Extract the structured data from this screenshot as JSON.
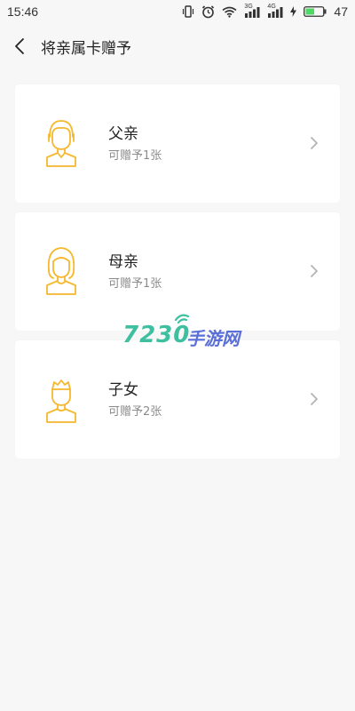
{
  "status_bar": {
    "time": "15:46",
    "sim1_label": "3G",
    "sim2_label": "4G",
    "battery_percent": "47",
    "icons": [
      "vibrate-icon",
      "alarm-icon",
      "wifi-icon",
      "signal-icon",
      "signal-icon",
      "charging-icon",
      "battery-icon"
    ]
  },
  "header": {
    "back_icon": "chevron-left-icon",
    "title": "将亲属卡赠予"
  },
  "cards": [
    {
      "name": "父亲",
      "sub": "可赠予1张",
      "avatar_icon": "father-avatar-icon"
    },
    {
      "name": "母亲",
      "sub": "可赠予1张",
      "avatar_icon": "mother-avatar-icon"
    },
    {
      "name": "子女",
      "sub": "可赠予2张",
      "avatar_icon": "child-avatar-icon"
    }
  ],
  "watermark": {
    "number": "7230",
    "text": "手游网"
  },
  "colors": {
    "background": "#f7f7f7",
    "card": "#ffffff",
    "avatar_stroke": "#f5b82e",
    "subtext": "#8c8c8c",
    "chevron": "#b3b3b3",
    "battery_green": "#4cd964"
  }
}
